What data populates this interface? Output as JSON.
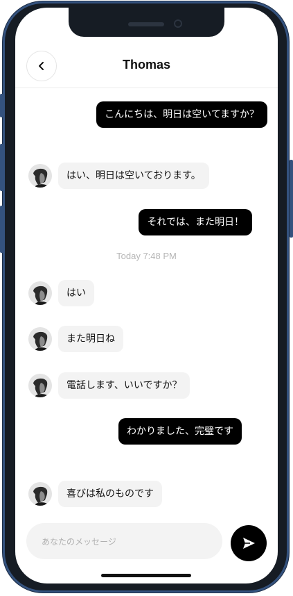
{
  "header": {
    "title": "Thomas"
  },
  "messages": [
    {
      "side": "out",
      "text": "こんにちは、明日は空いてますか？"
    },
    {
      "side": "in",
      "text": "はい、明日は空いております。"
    },
    {
      "side": "out",
      "text": "それでは、また明日！"
    },
    {
      "side": "in",
      "text": "はい"
    },
    {
      "side": "in",
      "text": "また明日ね"
    },
    {
      "side": "in",
      "text": "電話します、いいですか？"
    },
    {
      "side": "out",
      "text": "わかりました、完璧です"
    },
    {
      "side": "in",
      "text": "喜びは私のものです"
    }
  ],
  "timestamp": "Today 7:48 PM",
  "composer": {
    "placeholder": "あなたのメッセージ",
    "value": ""
  },
  "icons": {
    "back": "chevron-left-icon",
    "send": "send-icon"
  },
  "colors": {
    "outgoing_bubble": "#000000",
    "incoming_bubble": "#f3f3f3",
    "frame_accent": "#34527e"
  }
}
